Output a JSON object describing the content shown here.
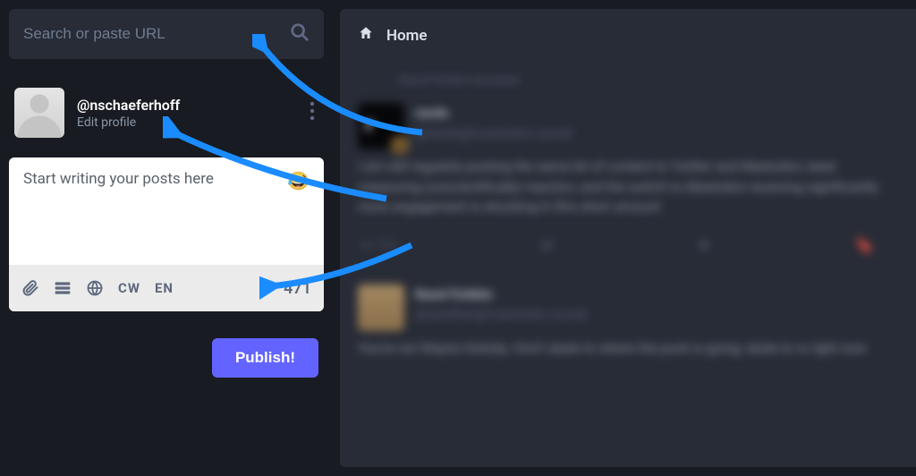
{
  "search": {
    "placeholder": "Search or paste URL"
  },
  "profile": {
    "handle": "@nschaeferhoff",
    "edit_label": "Edit profile"
  },
  "composer": {
    "placeholder": "Start writing your posts here",
    "cw_label": "CW",
    "lang_label": "EN",
    "char_count": "471",
    "publish_label": "Publish!"
  },
  "timeline": {
    "title": "Home",
    "boosted_label": "Rand Fishkin boosted",
    "post1": {
      "name": "rands",
      "handle": "@rands@mastodon.social",
      "body": "I am still regularly posting the same bit of content to Twitter and Mastodon, been measuring (unscientifically) reaction, and the switch to Mastodon receiving significantly more engagement is shocking in this short amount",
      "reply_count": "1+"
    },
    "post2": {
      "name": "Rand Fishkin",
      "handle": "@randfish@mastodon.social",
      "body": "You're not Wayne Gretzky. Don't skate to where the puck is going; skate to is right now."
    }
  },
  "colors": {
    "accent": "#6364ff"
  }
}
